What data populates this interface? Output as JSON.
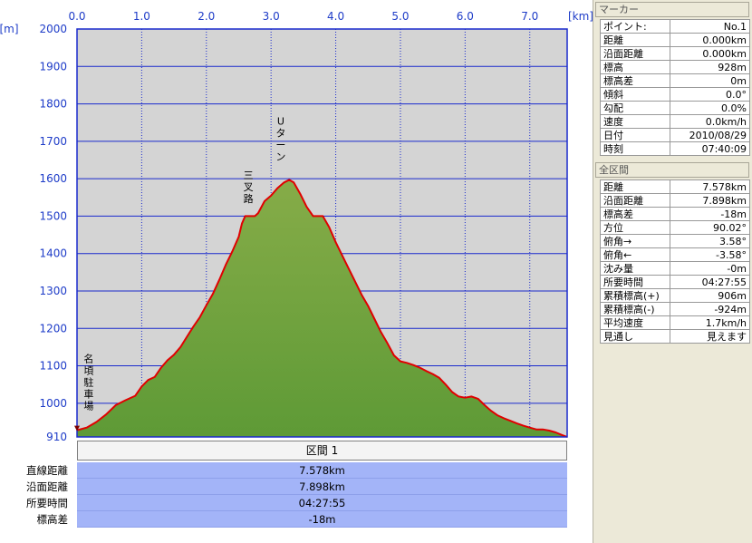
{
  "chart_data": {
    "type": "area",
    "x_unit": "[km]",
    "y_unit": "[m]",
    "xlim": [
      0,
      7.578
    ],
    "ylim": [
      910,
      2000
    ],
    "x_ticks": [
      "0.0",
      "1.0",
      "2.0",
      "3.0",
      "4.0",
      "5.0",
      "6.0",
      "7.0"
    ],
    "y_ticks": [
      "2000",
      "1900",
      "1800",
      "1700",
      "1600",
      "1500",
      "1400",
      "1300",
      "1200",
      "1100",
      "1000",
      "910"
    ],
    "grid": true,
    "profile": [
      [
        0.0,
        928
      ],
      [
        0.15,
        935
      ],
      [
        0.3,
        950
      ],
      [
        0.45,
        970
      ],
      [
        0.6,
        995
      ],
      [
        0.75,
        1008
      ],
      [
        0.9,
        1020
      ],
      [
        1.0,
        1045
      ],
      [
        1.1,
        1062
      ],
      [
        1.2,
        1070
      ],
      [
        1.3,
        1095
      ],
      [
        1.4,
        1115
      ],
      [
        1.5,
        1130
      ],
      [
        1.6,
        1150
      ],
      [
        1.7,
        1178
      ],
      [
        1.8,
        1205
      ],
      [
        1.9,
        1230
      ],
      [
        2.0,
        1262
      ],
      [
        2.1,
        1292
      ],
      [
        2.2,
        1330
      ],
      [
        2.3,
        1370
      ],
      [
        2.4,
        1405
      ],
      [
        2.5,
        1445
      ],
      [
        2.55,
        1480
      ],
      [
        2.6,
        1500
      ],
      [
        2.75,
        1500
      ],
      [
        2.8,
        1508
      ],
      [
        2.9,
        1540
      ],
      [
        3.0,
        1555
      ],
      [
        3.1,
        1575
      ],
      [
        3.2,
        1590
      ],
      [
        3.28,
        1597
      ],
      [
        3.35,
        1590
      ],
      [
        3.45,
        1560
      ],
      [
        3.55,
        1525
      ],
      [
        3.65,
        1500
      ],
      [
        3.8,
        1500
      ],
      [
        3.9,
        1470
      ],
      [
        4.0,
        1430
      ],
      [
        4.1,
        1395
      ],
      [
        4.2,
        1360
      ],
      [
        4.3,
        1325
      ],
      [
        4.4,
        1290
      ],
      [
        4.5,
        1260
      ],
      [
        4.6,
        1225
      ],
      [
        4.7,
        1190
      ],
      [
        4.8,
        1160
      ],
      [
        4.9,
        1128
      ],
      [
        5.0,
        1112
      ],
      [
        5.1,
        1108
      ],
      [
        5.2,
        1102
      ],
      [
        5.3,
        1095
      ],
      [
        5.4,
        1086
      ],
      [
        5.5,
        1078
      ],
      [
        5.6,
        1068
      ],
      [
        5.7,
        1050
      ],
      [
        5.8,
        1030
      ],
      [
        5.9,
        1018
      ],
      [
        6.0,
        1015
      ],
      [
        6.1,
        1018
      ],
      [
        6.2,
        1012
      ],
      [
        6.3,
        995
      ],
      [
        6.4,
        980
      ],
      [
        6.5,
        968
      ],
      [
        6.6,
        960
      ],
      [
        6.7,
        953
      ],
      [
        6.8,
        946
      ],
      [
        6.9,
        940
      ],
      [
        7.0,
        935
      ],
      [
        7.1,
        930
      ],
      [
        7.2,
        930
      ],
      [
        7.3,
        927
      ],
      [
        7.4,
        922
      ],
      [
        7.5,
        915
      ],
      [
        7.578,
        910
      ]
    ],
    "annotations": [
      {
        "text": "名頃駐車場",
        "x": 0.18,
        "y": 1110
      },
      {
        "text": "三叉路",
        "x": 2.65,
        "y": 1600
      },
      {
        "text": "Uターン",
        "x": 3.15,
        "y": 1745
      }
    ],
    "line_color": "#e00000",
    "fill_color": "#5e9a36",
    "fill_top_color": "#86ac48",
    "plot_bg": "#d4d4d4",
    "grid_color": "#1a2acd"
  },
  "section": {
    "title": "区間 1",
    "rows": [
      {
        "label": "直線距離",
        "value": "7.578km"
      },
      {
        "label": "沿面距離",
        "value": "7.898km"
      },
      {
        "label": "所要時間",
        "value": "04:27:55"
      },
      {
        "label": "標高差",
        "value": "-18m"
      }
    ]
  },
  "marker_panel": {
    "title": "マーカー",
    "rows": [
      {
        "key": "ポイント:",
        "value": "No.1"
      },
      {
        "key": "距離",
        "value": "0.000km"
      },
      {
        "key": "沿面距離",
        "value": "0.000km"
      },
      {
        "key": "標高",
        "value": "928m"
      },
      {
        "key": "標高差",
        "value": "0m"
      },
      {
        "key": "傾斜",
        "value": "0.0°"
      },
      {
        "key": "勾配",
        "value": "0.0%"
      },
      {
        "key": "速度",
        "value": "0.0km/h"
      },
      {
        "key": "日付",
        "value": "2010/08/29"
      },
      {
        "key": "時刻",
        "value": "07:40:09"
      }
    ]
  },
  "total_panel": {
    "title": "全区間",
    "rows": [
      {
        "key": "距離",
        "value": "7.578km"
      },
      {
        "key": "沿面距離",
        "value": "7.898km"
      },
      {
        "key": "標高差",
        "value": "-18m"
      },
      {
        "key": "方位",
        "value": "90.02°"
      },
      {
        "key": "俯角→",
        "value": "3.58°"
      },
      {
        "key": "俯角←",
        "value": "-3.58°"
      },
      {
        "key": "沈み量",
        "value": "-0m"
      },
      {
        "key": "所要時間",
        "value": "04:27:55"
      },
      {
        "key": "累積標高(+)",
        "value": "906m"
      },
      {
        "key": "累積標高(-)",
        "value": "-924m"
      },
      {
        "key": "平均速度",
        "value": "1.7km/h"
      },
      {
        "key": "見通し",
        "value": "見えます"
      }
    ]
  }
}
